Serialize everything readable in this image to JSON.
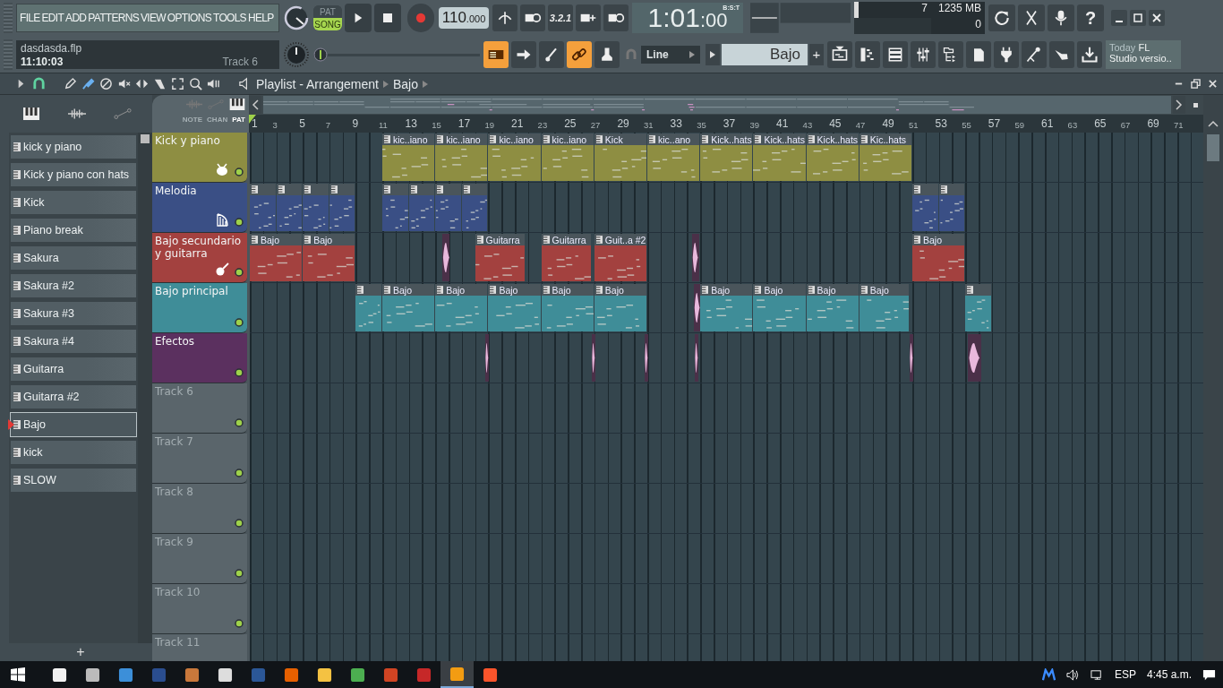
{
  "menu": [
    "FILE",
    "EDIT",
    "ADD",
    "PATTERNS",
    "VIEW",
    "OPTIONS",
    "TOOLS",
    "HELP"
  ],
  "project": {
    "file": "dasdasda.flp",
    "time": "11:10:03",
    "track": "Track 6"
  },
  "transport": {
    "modes": [
      {
        "label": "PAT",
        "selected": false
      },
      {
        "label": "SONG",
        "selected": true
      }
    ],
    "tempo": "110",
    "tempo_decimals": ".000",
    "countdown": "3.2.1"
  },
  "master_pitch": {
    "level": 0
  },
  "song_position": {
    "main": "1:01",
    "ticks": ":00",
    "format": "B:S:T"
  },
  "cpu": {
    "polyphony": "7",
    "memory": "1235 MB",
    "voices": "0"
  },
  "help": "?",
  "toolbar_toggles": [
    {
      "on": true
    },
    {
      "on": false
    },
    {
      "on": false
    },
    {
      "on": true
    },
    {
      "on": false
    }
  ],
  "snap": "Line",
  "current_pattern": "Bajo",
  "add": "+",
  "hint": {
    "label": "Today",
    "app": "FL",
    "text": "Studio versio.."
  },
  "playlist": {
    "title": "Playlist - Arrangement",
    "pattern": "Bajo",
    "filter_tabs": [
      {
        "label": "NOTE",
        "selected": false
      },
      {
        "label": "CHAN",
        "selected": false
      },
      {
        "label": "PAT",
        "selected": true
      }
    ],
    "ruler": [
      "1",
      "3",
      "5",
      "7",
      "9",
      "11",
      "13",
      "15",
      "17",
      "19",
      "21",
      "23",
      "25",
      "27",
      "29",
      "31",
      "33",
      "35",
      "37",
      "39",
      "41",
      "43",
      "45",
      "47",
      "49",
      "51",
      "53",
      "55",
      "57",
      "59",
      "61",
      "63",
      "65",
      "67",
      "69",
      "71"
    ],
    "tracks": [
      {
        "name": "Kick y piano",
        "color": "#8e8e42",
        "kind": "drum",
        "enabled": true,
        "clips": [
          {
            "kind": "pattern",
            "label": "kic..iano"
          },
          {
            "kind": "pattern",
            "label": "kic..iano"
          },
          {
            "kind": "pattern",
            "label": "kic..iano"
          },
          {
            "kind": "pattern",
            "label": "kic..iano"
          },
          {
            "kind": "pattern",
            "label": "Kick"
          },
          {
            "kind": "pattern",
            "label": "kic..ano"
          },
          {
            "kind": "pattern",
            "label": "Kick..hats"
          },
          {
            "kind": "pattern",
            "label": "Kick..hats"
          },
          {
            "kind": "pattern",
            "label": "Kick..hats"
          },
          {
            "kind": "pattern",
            "label": "Kic..hats"
          }
        ]
      },
      {
        "name": "Melodia",
        "color": "#3a4f85",
        "kind": "harp",
        "enabled": true,
        "clips": [
          {
            "kind": "pattern"
          },
          {
            "kind": "pattern"
          },
          {
            "kind": "pattern"
          },
          {
            "kind": "pattern"
          },
          {
            "kind": "pattern"
          },
          {
            "kind": "pattern"
          },
          {
            "kind": "pattern"
          },
          {
            "kind": "pattern"
          },
          {
            "kind": "pattern"
          },
          {
            "kind": "pattern"
          }
        ]
      },
      {
        "name": "Bajo secundario y guitarra",
        "color": "#a3413f",
        "kind": "guitar",
        "enabled": true,
        "clips": [
          {
            "kind": "pattern",
            "label": "Bajo"
          },
          {
            "kind": "pattern",
            "label": "Bajo"
          },
          {
            "kind": "audio"
          },
          {
            "kind": "pattern",
            "label": "Guitarra"
          },
          {
            "kind": "pattern",
            "label": "Guitarra"
          },
          {
            "kind": "pattern",
            "label": "Guit..a #2"
          },
          {
            "kind": "audio"
          },
          {
            "kind": "pattern",
            "label": "Bajo"
          }
        ]
      },
      {
        "name": "Bajo principal",
        "color": "#3f8d98",
        "kind": "none",
        "enabled": true,
        "clips": [
          {
            "kind": "pattern"
          },
          {
            "kind": "pattern",
            "label": "Bajo"
          },
          {
            "kind": "pattern",
            "label": "Bajo"
          },
          {
            "kind": "pattern",
            "label": "Bajo"
          },
          {
            "kind": "pattern",
            "label": "Bajo"
          },
          {
            "kind": "pattern",
            "label": "Bajo"
          },
          {
            "kind": "audio"
          },
          {
            "kind": "pattern",
            "label": "Bajo"
          },
          {
            "kind": "pattern",
            "label": "Bajo"
          },
          {
            "kind": "pattern",
            "label": "Bajo"
          },
          {
            "kind": "pattern",
            "label": "Bajo"
          },
          {
            "kind": "pattern"
          }
        ]
      },
      {
        "name": "Efectos",
        "color": "#5b305f",
        "kind": "none",
        "enabled": true,
        "clips": [
          {
            "kind": "audio"
          },
          {
            "kind": "audio"
          },
          {
            "kind": "audio"
          },
          {
            "kind": "audio"
          },
          {
            "kind": "audio"
          },
          {
            "kind": "audio"
          }
        ]
      },
      {
        "name": "Track 6",
        "kind": "none",
        "enabled": true
      },
      {
        "name": "Track 7",
        "kind": "none",
        "enabled": true
      },
      {
        "name": "Track 8",
        "kind": "none",
        "enabled": true
      },
      {
        "name": "Track 9",
        "kind": "none",
        "enabled": true
      },
      {
        "name": "Track 10",
        "kind": "none",
        "enabled": true
      },
      {
        "name": "Track 11",
        "kind": "none"
      }
    ]
  },
  "patterns": [
    {
      "name": "kick y piano",
      "selected": false
    },
    {
      "name": "Kick y piano con hats",
      "selected": false
    },
    {
      "name": "Kick",
      "selected": false
    },
    {
      "name": "Piano break",
      "selected": false
    },
    {
      "name": "Sakura",
      "selected": false
    },
    {
      "name": "Sakura #2",
      "selected": false
    },
    {
      "name": "Sakura #3",
      "selected": false
    },
    {
      "name": "Sakura #4",
      "selected": false
    },
    {
      "name": "Guitarra",
      "selected": false
    },
    {
      "name": "Guitarra #2",
      "selected": false
    },
    {
      "name": "Bajo",
      "selected": true
    },
    {
      "name": "kick",
      "selected": false
    },
    {
      "name": "SLOW",
      "selected": false
    }
  ],
  "pattern_add": "+",
  "taskbar": {
    "language": "ESP",
    "clock": "4:45 a.m."
  }
}
